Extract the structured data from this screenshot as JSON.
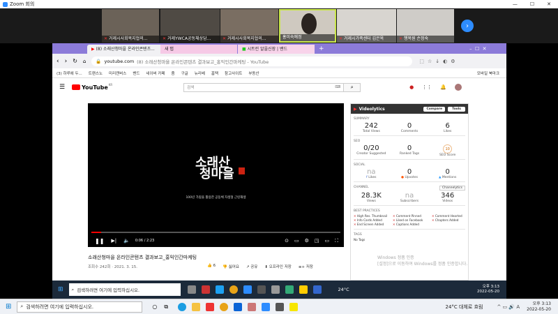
{
  "zoom": {
    "title": "Zoom 회의",
    "participants": [
      {
        "name": "거제시사회복지협의...",
        "muted": true
      },
      {
        "name": "거제YWCA공동체상담...",
        "muted": true
      },
      {
        "name": "거제시사회복지협의...",
        "muted": true
      },
      {
        "name": "홍미숙예정",
        "muted": false
      },
      {
        "name": "거제시가족센터 김은옥",
        "muted": true
      },
      {
        "name": "행복원 손정숙",
        "muted": true
      }
    ]
  },
  "browser": {
    "tabs": [
      {
        "label": "(8) 소래산청마을 온라인콘텐츠...",
        "active": true
      },
      {
        "label": "새 탭",
        "active": false
      },
      {
        "label": "시트린 알을신장 | 밴드",
        "active": false
      }
    ],
    "url_domain": "youtube.com",
    "url_rest": "(8) 소래산청마을 온라인콘텐츠 결과보고_홍익인간마케팅 - YouTube",
    "bookmarks": [
      "(3) 하루에 두...",
      "트랜스노",
      "미리캔버스",
      "밴드",
      "네이버 카페",
      "줌",
      "구글",
      "뉴리베",
      "홈택",
      "참고사이트",
      "부동산"
    ],
    "bookmark_right": "모바일 북마크"
  },
  "youtube": {
    "logo": "YouTube",
    "region": "KR",
    "search_placeholder": "검색",
    "video": {
      "logo_line1": "소래산",
      "logo_line2": "청마을",
      "subtitle": "100년 가람을 활용한 공동체 자생형 근린재생",
      "time": "0:06 / 2:23",
      "progress": 0.04
    },
    "title": "소래산청마을 온라인콘텐츠 결과보고_홍익인간마케팅",
    "meta": "조회수 242회 · 2021. 3. 15.",
    "actions": {
      "likes": "6",
      "dislike": "싫어요",
      "share": "공유",
      "clip": "오프라인 저장",
      "save": "저장"
    }
  },
  "videolytics": {
    "name": "Videolytics",
    "compare": "Compare",
    "tools": "Tools",
    "summary_title": "SUMMARY",
    "summary": [
      {
        "value": "242",
        "label": "Total Views"
      },
      {
        "value": "0",
        "label": "Comments"
      },
      {
        "value": "6",
        "label": "Likes"
      }
    ],
    "seo_title": "SEO",
    "seo": [
      {
        "value": "0/20",
        "label": "Creator Suggested"
      },
      {
        "value": "0",
        "label": "Ranked Tags"
      },
      {
        "value": "10",
        "label": "SEO Score"
      }
    ],
    "social_title": "SOCIAL",
    "social": [
      {
        "value": "na",
        "label": "Likes"
      },
      {
        "value": "0",
        "label": "Upvotes"
      },
      {
        "value": "0",
        "label": "Mentions"
      }
    ],
    "channel_title": "CHANNEL",
    "channel_link": "Channelytics",
    "channel": [
      {
        "value": "28.3K",
        "label": "Views"
      },
      {
        "value": "na",
        "label": "Subscribers"
      },
      {
        "value": "346",
        "label": "Videos"
      }
    ],
    "bp_title": "BEST PRACTICES",
    "best_practices": [
      "High Res. Thumbnail",
      "Comment Pinned",
      "Comment Hearted",
      "Info Cards Added",
      "Liked on Facebook",
      "Chapters Added",
      "End Screen Added",
      "Captions Added"
    ],
    "tags_title": "TAGS",
    "tags_value": "No Tags"
  },
  "activate": {
    "line1": "Windows 정품 인증",
    "line2": "[설정]으로 이동하여 Windows를 정품 인증합니다."
  },
  "taskbar": {
    "search": "검색하려면 여기에 입력하십시오.",
    "weather": "24°C 대체로 흐림",
    "time": "오후 3:13",
    "date": "2022-05-20",
    "remote_weather": "24°C",
    "remote_time": "오후 3:13",
    "remote_date": "2022-05-20"
  }
}
